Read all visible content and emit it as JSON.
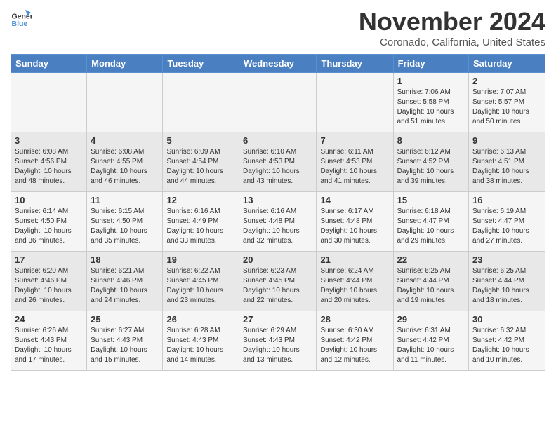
{
  "header": {
    "logo_line1": "General",
    "logo_line2": "Blue",
    "month_title": "November 2024",
    "location": "Coronado, California, United States"
  },
  "days_of_week": [
    "Sunday",
    "Monday",
    "Tuesday",
    "Wednesday",
    "Thursday",
    "Friday",
    "Saturday"
  ],
  "weeks": [
    [
      {
        "day": "",
        "info": ""
      },
      {
        "day": "",
        "info": ""
      },
      {
        "day": "",
        "info": ""
      },
      {
        "day": "",
        "info": ""
      },
      {
        "day": "",
        "info": ""
      },
      {
        "day": "1",
        "info": "Sunrise: 7:06 AM\nSunset: 5:58 PM\nDaylight: 10 hours\nand 51 minutes."
      },
      {
        "day": "2",
        "info": "Sunrise: 7:07 AM\nSunset: 5:57 PM\nDaylight: 10 hours\nand 50 minutes."
      }
    ],
    [
      {
        "day": "3",
        "info": "Sunrise: 6:08 AM\nSunset: 4:56 PM\nDaylight: 10 hours\nand 48 minutes."
      },
      {
        "day": "4",
        "info": "Sunrise: 6:08 AM\nSunset: 4:55 PM\nDaylight: 10 hours\nand 46 minutes."
      },
      {
        "day": "5",
        "info": "Sunrise: 6:09 AM\nSunset: 4:54 PM\nDaylight: 10 hours\nand 44 minutes."
      },
      {
        "day": "6",
        "info": "Sunrise: 6:10 AM\nSunset: 4:53 PM\nDaylight: 10 hours\nand 43 minutes."
      },
      {
        "day": "7",
        "info": "Sunrise: 6:11 AM\nSunset: 4:53 PM\nDaylight: 10 hours\nand 41 minutes."
      },
      {
        "day": "8",
        "info": "Sunrise: 6:12 AM\nSunset: 4:52 PM\nDaylight: 10 hours\nand 39 minutes."
      },
      {
        "day": "9",
        "info": "Sunrise: 6:13 AM\nSunset: 4:51 PM\nDaylight: 10 hours\nand 38 minutes."
      }
    ],
    [
      {
        "day": "10",
        "info": "Sunrise: 6:14 AM\nSunset: 4:50 PM\nDaylight: 10 hours\nand 36 minutes."
      },
      {
        "day": "11",
        "info": "Sunrise: 6:15 AM\nSunset: 4:50 PM\nDaylight: 10 hours\nand 35 minutes."
      },
      {
        "day": "12",
        "info": "Sunrise: 6:16 AM\nSunset: 4:49 PM\nDaylight: 10 hours\nand 33 minutes."
      },
      {
        "day": "13",
        "info": "Sunrise: 6:16 AM\nSunset: 4:48 PM\nDaylight: 10 hours\nand 32 minutes."
      },
      {
        "day": "14",
        "info": "Sunrise: 6:17 AM\nSunset: 4:48 PM\nDaylight: 10 hours\nand 30 minutes."
      },
      {
        "day": "15",
        "info": "Sunrise: 6:18 AM\nSunset: 4:47 PM\nDaylight: 10 hours\nand 29 minutes."
      },
      {
        "day": "16",
        "info": "Sunrise: 6:19 AM\nSunset: 4:47 PM\nDaylight: 10 hours\nand 27 minutes."
      }
    ],
    [
      {
        "day": "17",
        "info": "Sunrise: 6:20 AM\nSunset: 4:46 PM\nDaylight: 10 hours\nand 26 minutes."
      },
      {
        "day": "18",
        "info": "Sunrise: 6:21 AM\nSunset: 4:46 PM\nDaylight: 10 hours\nand 24 minutes."
      },
      {
        "day": "19",
        "info": "Sunrise: 6:22 AM\nSunset: 4:45 PM\nDaylight: 10 hours\nand 23 minutes."
      },
      {
        "day": "20",
        "info": "Sunrise: 6:23 AM\nSunset: 4:45 PM\nDaylight: 10 hours\nand 22 minutes."
      },
      {
        "day": "21",
        "info": "Sunrise: 6:24 AM\nSunset: 4:44 PM\nDaylight: 10 hours\nand 20 minutes."
      },
      {
        "day": "22",
        "info": "Sunrise: 6:25 AM\nSunset: 4:44 PM\nDaylight: 10 hours\nand 19 minutes."
      },
      {
        "day": "23",
        "info": "Sunrise: 6:25 AM\nSunset: 4:44 PM\nDaylight: 10 hours\nand 18 minutes."
      }
    ],
    [
      {
        "day": "24",
        "info": "Sunrise: 6:26 AM\nSunset: 4:43 PM\nDaylight: 10 hours\nand 17 minutes."
      },
      {
        "day": "25",
        "info": "Sunrise: 6:27 AM\nSunset: 4:43 PM\nDaylight: 10 hours\nand 15 minutes."
      },
      {
        "day": "26",
        "info": "Sunrise: 6:28 AM\nSunset: 4:43 PM\nDaylight: 10 hours\nand 14 minutes."
      },
      {
        "day": "27",
        "info": "Sunrise: 6:29 AM\nSunset: 4:43 PM\nDaylight: 10 hours\nand 13 minutes."
      },
      {
        "day": "28",
        "info": "Sunrise: 6:30 AM\nSunset: 4:42 PM\nDaylight: 10 hours\nand 12 minutes."
      },
      {
        "day": "29",
        "info": "Sunrise: 6:31 AM\nSunset: 4:42 PM\nDaylight: 10 hours\nand 11 minutes."
      },
      {
        "day": "30",
        "info": "Sunrise: 6:32 AM\nSunset: 4:42 PM\nDaylight: 10 hours\nand 10 minutes."
      }
    ]
  ]
}
